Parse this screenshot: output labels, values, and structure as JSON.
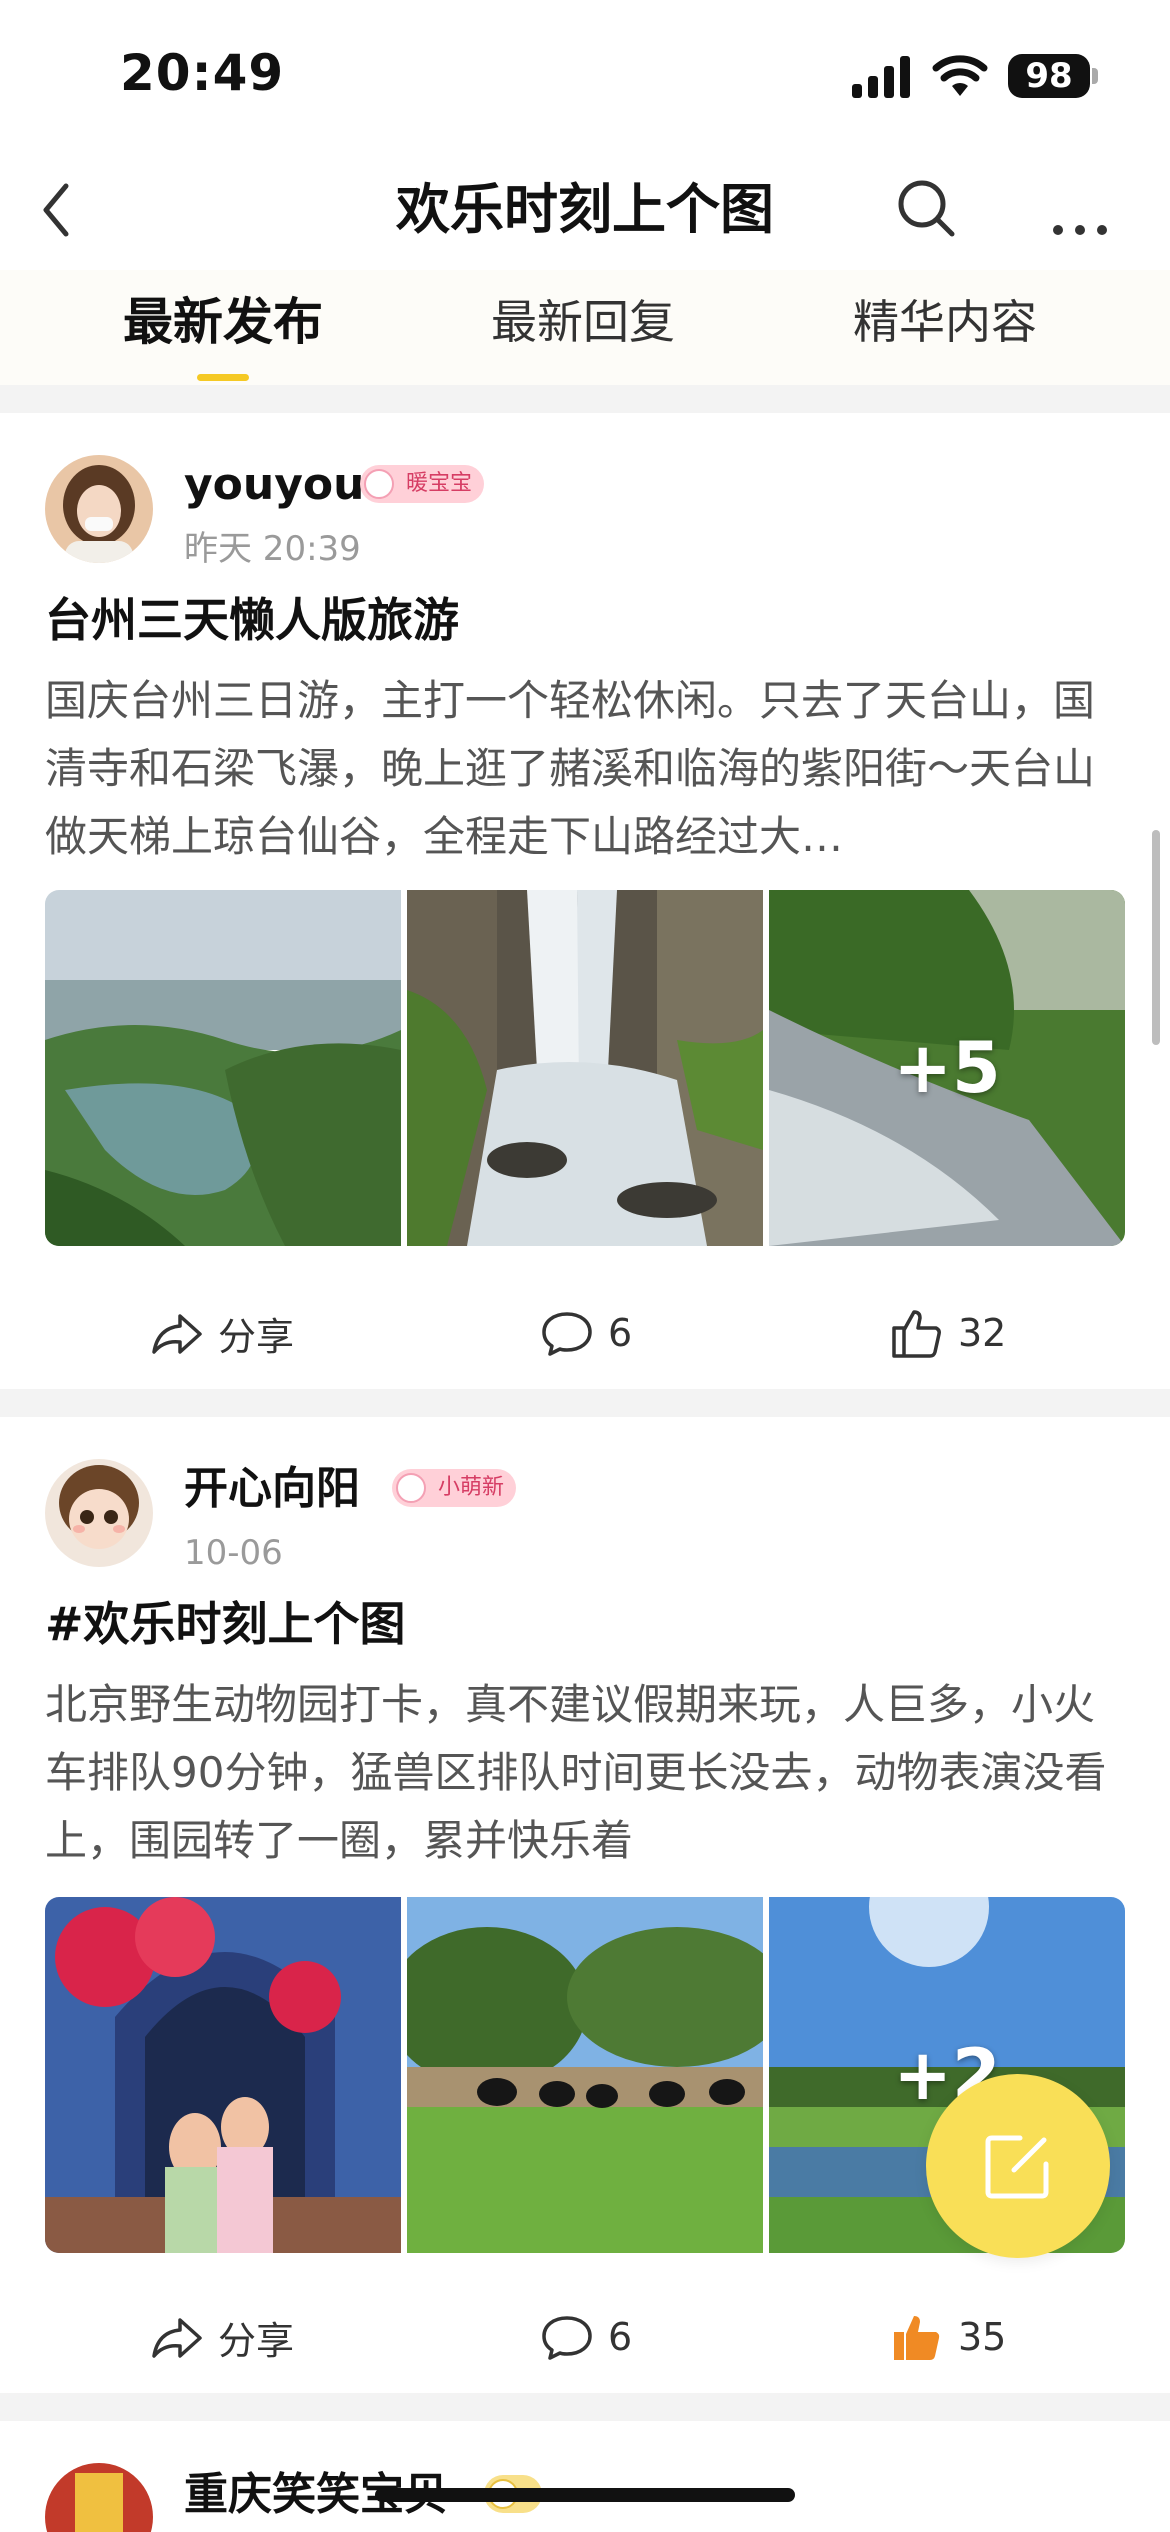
{
  "status_bar": {
    "time": "20:49",
    "battery": "98"
  },
  "nav": {
    "title": "欢乐时刻上个图"
  },
  "tabs": [
    {
      "label": "最新发布",
      "active": true
    },
    {
      "label": "最新回复",
      "active": false
    },
    {
      "label": "精华内容",
      "active": false
    }
  ],
  "posts": [
    {
      "username": "youyou",
      "badge": "暖宝宝",
      "time": "昨天 20:39",
      "title": "台州三天懒人版旅游",
      "body": "国庆台州三日游，主打一个轻松休闲。只去了天台山，国清寺和石梁飞瀑，晚上逛了赭溪和临海的紫阳街～天台山做天梯上琼台仙谷，全程走下山路经过大…",
      "photos": [
        "湖泊山景",
        "瀑布",
        "山间瀑布"
      ],
      "more_photos": "+5",
      "share_label": "分享",
      "comments": "6",
      "likes": "32",
      "liked": false
    },
    {
      "username": "开心向阳",
      "badge": "小萌新",
      "time": "10-06",
      "title": "#欢乐时刻上个图",
      "body": "北京野生动物园打卡，真不建议假期来玩，人巨多，小火车排队90分钟，猛兽区排队时间更长没去，动物表演没看上，围园转了一圈，累并快乐着",
      "photos": [
        "花门下的孩子",
        "草地上的黑熊",
        "湖边草坪"
      ],
      "more_photos": "+2",
      "share_label": "分享",
      "comments": "6",
      "likes": "35",
      "liked": true
    },
    {
      "username": "重庆笑笑宝贝",
      "badge": ""
    }
  ],
  "colors": {
    "accent": "#f5c924",
    "badge_bg": "#ffd0d8",
    "badge_text": "#d63d64",
    "liked": "#f08a24",
    "fab": "#f9df57"
  }
}
